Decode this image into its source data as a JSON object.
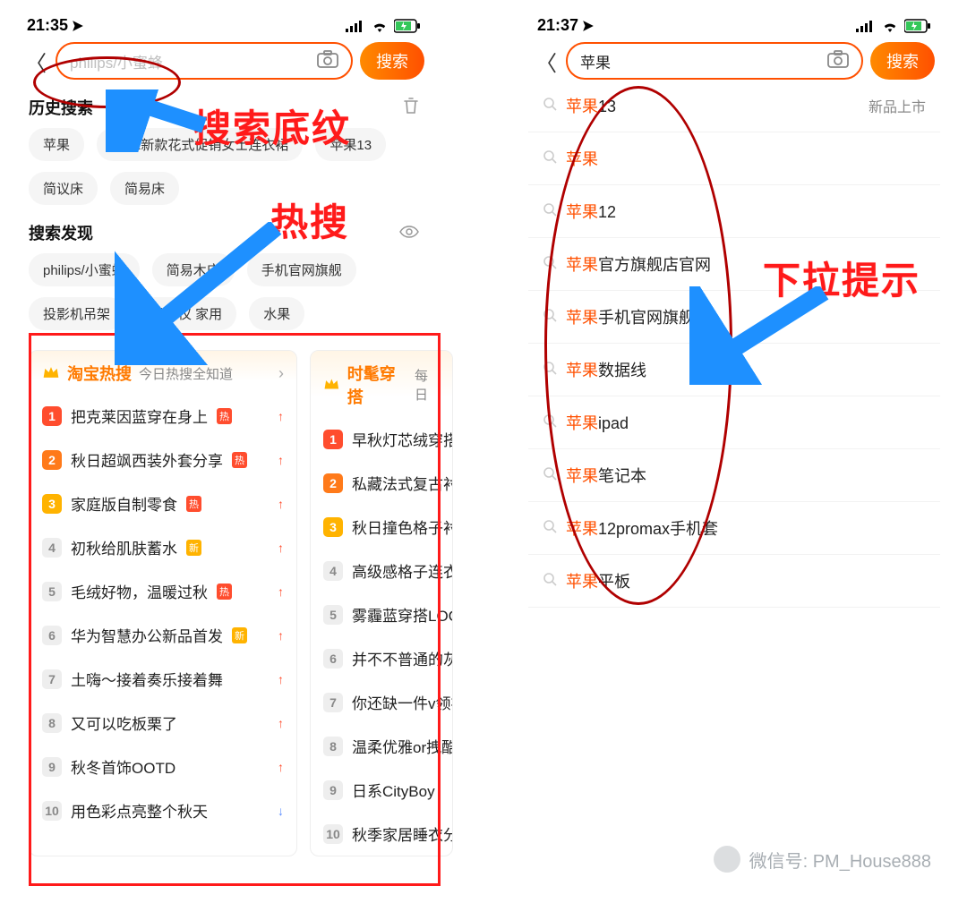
{
  "annotations": {
    "search_hint": "搜索底纹",
    "hot_search": "热搜",
    "dropdown_hint": "下拉提示"
  },
  "left": {
    "time": "21:35",
    "search_placeholder": "philips/小蜜蜂",
    "search_btn": "搜索",
    "history_title": "历史搜索",
    "history": [
      "苹果",
      "2021新款花式促销女士连衣裙",
      "苹果13",
      "简议床",
      "简易床"
    ],
    "discover_title": "搜索发现",
    "discover": [
      "philips/小蜜蜂",
      "简易木床",
      "手机官网旗舰",
      "投影机吊架",
      "投影仪 家用",
      "水果"
    ],
    "hot_primary": {
      "title": "淘宝热搜",
      "sub": "今日热搜全知道",
      "items": [
        {
          "rank": 1,
          "text": "把克莱因蓝穿在身上",
          "badge": "热",
          "trend": "up"
        },
        {
          "rank": 2,
          "text": "秋日超飒西装外套分享",
          "badge": "热",
          "trend": "up"
        },
        {
          "rank": 3,
          "text": "家庭版自制零食",
          "badge": "热",
          "trend": "up"
        },
        {
          "rank": 4,
          "text": "初秋给肌肤蓄水",
          "badge": "新",
          "trend": "up"
        },
        {
          "rank": 5,
          "text": "毛绒好物，温暖过秋",
          "badge": "热",
          "trend": "up"
        },
        {
          "rank": 6,
          "text": "华为智慧办公新品首发",
          "badge": "新",
          "trend": "up"
        },
        {
          "rank": 7,
          "text": "土嗨～接着奏乐接着舞",
          "badge": "",
          "trend": "up"
        },
        {
          "rank": 8,
          "text": "又可以吃板栗了",
          "badge": "",
          "trend": "up"
        },
        {
          "rank": 9,
          "text": "秋冬首饰OOTD",
          "badge": "",
          "trend": "up"
        },
        {
          "rank": 10,
          "text": "用色彩点亮整个秋天",
          "badge": "",
          "trend": "down"
        }
      ]
    },
    "hot_secondary": {
      "title": "时髦穿搭",
      "sub": "每日",
      "items": [
        {
          "rank": 1,
          "text": "早秋灯芯绒穿搭"
        },
        {
          "rank": 2,
          "text": "私藏法式复古衬"
        },
        {
          "rank": 3,
          "text": "秋日撞色格子衬"
        },
        {
          "rank": 4,
          "text": "高级感格子连衣"
        },
        {
          "rank": 5,
          "text": "雾霾蓝穿搭LOC"
        },
        {
          "rank": 6,
          "text": "并不不普通的灰"
        },
        {
          "rank": 7,
          "text": "你还缺一件v领衬"
        },
        {
          "rank": 8,
          "text": "温柔优雅or拽酷"
        },
        {
          "rank": 9,
          "text": "日系CityBoy"
        },
        {
          "rank": 10,
          "text": "秋季家居睡衣分"
        }
      ]
    }
  },
  "right": {
    "time": "21:37",
    "search_value": "苹果",
    "search_btn": "搜索",
    "first_tag": "新品上市",
    "suggestions": [
      {
        "prefix": "苹果",
        "rest": "13"
      },
      {
        "prefix": "苹果",
        "rest": ""
      },
      {
        "prefix": "苹果",
        "rest": "12"
      },
      {
        "prefix": "苹果",
        "rest": "官方旗舰店官网"
      },
      {
        "prefix": "苹果",
        "rest": "手机官网旗舰"
      },
      {
        "prefix": "苹果",
        "rest": "数据线"
      },
      {
        "prefix": "苹果",
        "rest": "ipad"
      },
      {
        "prefix": "苹果",
        "rest": "笔记本"
      },
      {
        "prefix": "苹果",
        "rest": "12promax手机套"
      },
      {
        "prefix": "苹果",
        "rest": "平板"
      }
    ]
  },
  "watermark": "微信号: PM_House888"
}
